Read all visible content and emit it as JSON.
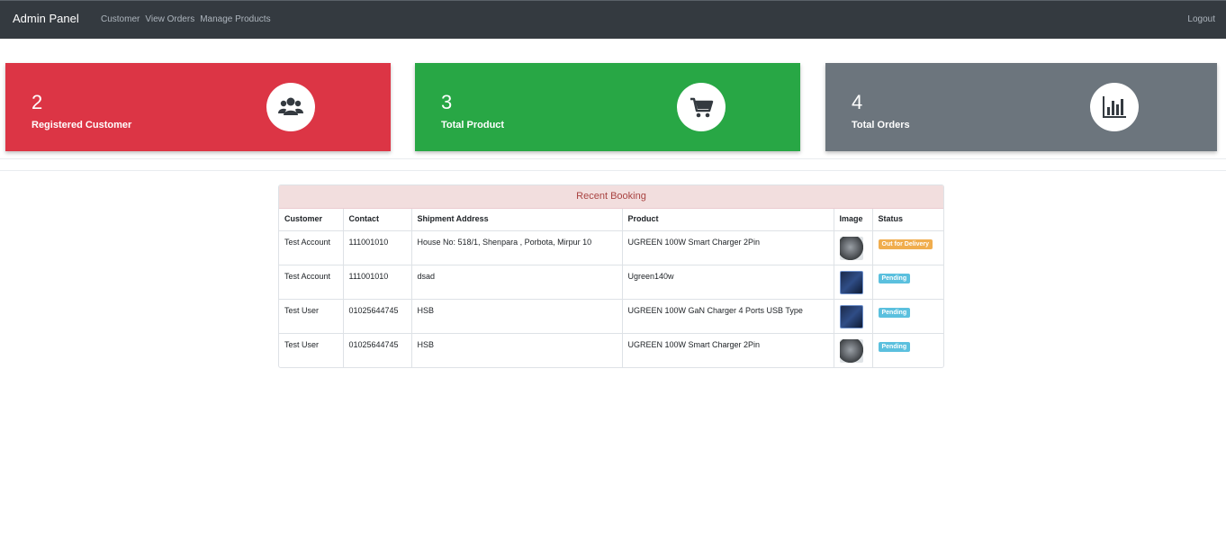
{
  "navbar": {
    "brand": "Admin Panel",
    "links": [
      "Customer",
      "View Orders",
      "Manage Products"
    ],
    "logout": "Logout"
  },
  "cards": [
    {
      "count": "2",
      "label": "Registered Customer",
      "icon": "users-icon",
      "color": "#dc3545"
    },
    {
      "count": "3",
      "label": "Total Product",
      "icon": "shopping-cart-icon",
      "color": "#28a745"
    },
    {
      "count": "4",
      "label": "Total Orders",
      "icon": "bar-chart-icon",
      "color": "#6c757d"
    }
  ],
  "booking": {
    "title": "Recent Booking",
    "columns": [
      "Customer",
      "Contact",
      "Shipment Address",
      "Product",
      "Image",
      "Status"
    ],
    "rows": [
      {
        "customer": "Test Account",
        "contact": "111001010",
        "address": "House No: 518/1, Shenpara , Porbota, Mirpur 10",
        "product": "UGREEN 100W Smart Charger 2Pin",
        "image": "charger-thumbnail",
        "status": "Out for Delivery",
        "status_color": "#f0ad4e"
      },
      {
        "customer": "Test Account",
        "contact": "111001010",
        "address": "dsad",
        "product": "Ugreen140w",
        "image": "product-box-thumbnail",
        "status": "Pending",
        "status_color": "#5bc0de"
      },
      {
        "customer": "Test User",
        "contact": "01025644745",
        "address": "HSB",
        "product": "UGREEN 100W GaN Charger 4 Ports USB Type",
        "image": "product-box-thumbnail",
        "status": "Pending",
        "status_color": "#5bc0de"
      },
      {
        "customer": "Test User",
        "contact": "01025644745",
        "address": "HSB",
        "product": "UGREEN 100W Smart Charger 2Pin",
        "image": "charger-thumbnail",
        "status": "Pending",
        "status_color": "#5bc0de"
      }
    ]
  }
}
